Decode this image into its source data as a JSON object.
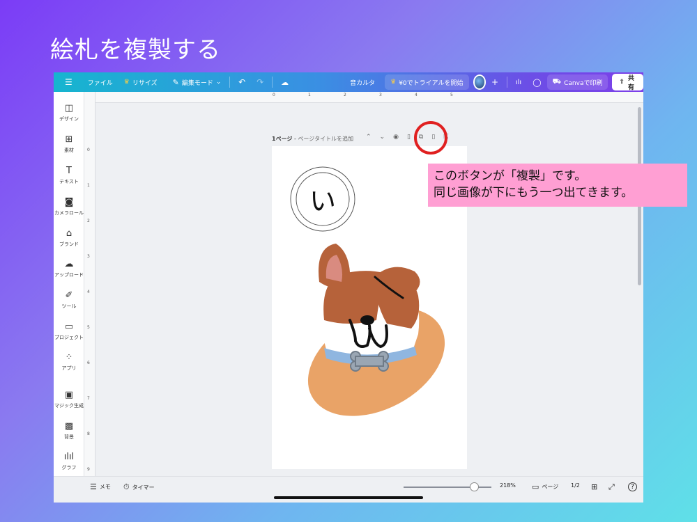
{
  "slide": {
    "title": "絵札を複製する"
  },
  "topbar": {
    "menu_icon": "hamburger-icon",
    "file": "ファイル",
    "resize": "リサイズ",
    "edit_mode": "編集モード",
    "doc_title": "音カルタ",
    "trial": "¥0でトライアルを開始",
    "print": "Canvaで印刷",
    "share": "共有"
  },
  "sidebar": {
    "items": [
      {
        "label": "デザイン",
        "icon": "design-icon"
      },
      {
        "label": "素材",
        "icon": "elements-icon"
      },
      {
        "label": "テキスト",
        "icon": "text-icon"
      },
      {
        "label": "カメラロール",
        "icon": "camera-icon"
      },
      {
        "label": "ブランド",
        "icon": "brand-icon"
      },
      {
        "label": "アップロード",
        "icon": "upload-icon"
      },
      {
        "label": "ツール",
        "icon": "tools-icon"
      },
      {
        "label": "プロジェクト",
        "icon": "folder-icon"
      },
      {
        "label": "アプリ",
        "icon": "apps-icon"
      },
      {
        "label": "マジック生成",
        "icon": "magic-icon"
      },
      {
        "label": "背景",
        "icon": "background-icon"
      },
      {
        "label": "グラフ",
        "icon": "chart-icon"
      }
    ]
  },
  "ruler": {
    "top": [
      "0",
      "1",
      "2",
      "3",
      "4",
      "5"
    ],
    "left": [
      "0",
      "1",
      "2",
      "3",
      "4",
      "5",
      "6",
      "7",
      "8",
      "9"
    ]
  },
  "page_header": {
    "page": "1ページ",
    "separator": " - ",
    "placeholder": "ページタイトルを追加"
  },
  "canvas": {
    "hiragana": "い"
  },
  "callout": {
    "line1": "このボタンが「複製」です。",
    "line2": "同じ画像が下にもう一つ出てきます。"
  },
  "bottombar": {
    "memo": "メモ",
    "timer": "タイマー",
    "zoom": "218%",
    "zoom_fraction": 0.8,
    "pages": "ページ",
    "page_count": "1/2"
  }
}
